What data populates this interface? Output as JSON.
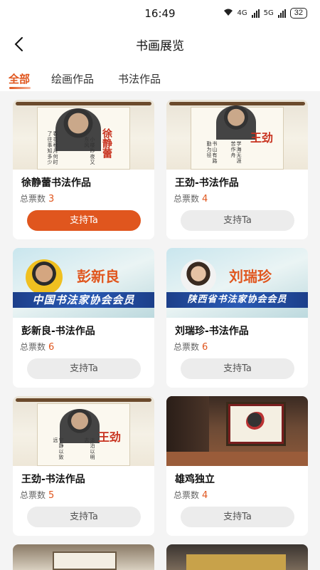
{
  "status_bar": {
    "time": "16:49",
    "battery": "32",
    "net1": "4G",
    "net2": "5G"
  },
  "header": {
    "title": "书画展览"
  },
  "tabs": [
    {
      "label": "全部",
      "active": true
    },
    {
      "label": "绘画作品",
      "active": false
    },
    {
      "label": "书法作品",
      "active": false
    }
  ],
  "votes_label": "总票数",
  "cards": [
    {
      "title": "徐静蕾书法作品",
      "votes": "3",
      "button": "支持Ta",
      "button_style": "primary",
      "seal": "徐静蕾"
    },
    {
      "title": "王劲-书法作品",
      "votes": "4",
      "button": "支持Ta",
      "button_style": "default",
      "seal": "王劲"
    },
    {
      "title": "彭新良-书法作品",
      "votes": "6",
      "button": "支持Ta",
      "button_style": "default",
      "banner_name": "彭新良",
      "banner_text": "中国书法家协会会员"
    },
    {
      "title": "刘瑞珍-书法作品",
      "votes": "6",
      "button": "支持Ta",
      "button_style": "default",
      "banner_name": "刘瑞珍",
      "banner_text": "陕西省书法家协会会员"
    },
    {
      "title": "王劲-书法作品",
      "votes": "5",
      "button": "支持Ta",
      "button_style": "default",
      "seal": "王劲"
    },
    {
      "title": "雄鸡独立",
      "votes": "4",
      "button": "支持Ta",
      "button_style": "default"
    }
  ],
  "colors": {
    "accent": "#e0561e",
    "button_bg": "#ececec"
  }
}
